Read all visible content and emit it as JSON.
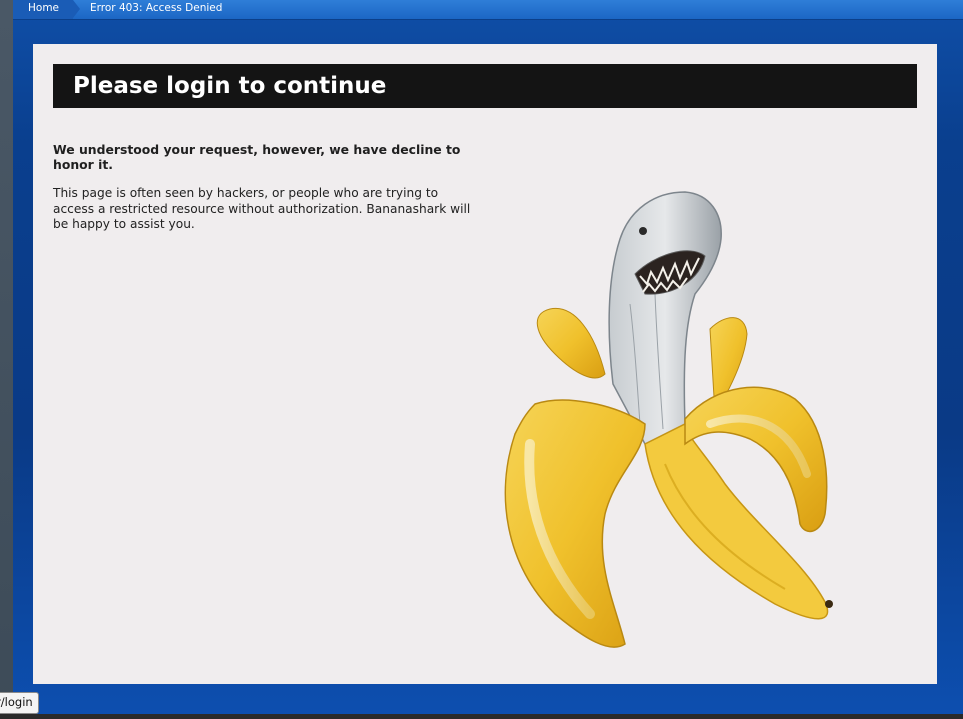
{
  "breadcrumb": {
    "home_label": "Home",
    "current_label": "Error 403: Access Denied"
  },
  "page": {
    "title": "Please login to continue",
    "lead": "We understood your request, however, we have decline to honor it.",
    "body": "This page is often seen by hackers, or people who are trying to access a restricted resource without authorization. Bananashark will be happy to assist you."
  },
  "illustration": {
    "icon": "bananashark-illustration"
  },
  "status_bar": {
    "url_text": "er/login"
  },
  "colors": {
    "frame_blue": "#0a3a86",
    "breadcrumb_blue": "#1c66c4",
    "title_bar": "#141414",
    "panel_bg": "#f0edee",
    "banana_yellow": "#f2c531",
    "shark_grey": "#b9bfc4"
  }
}
